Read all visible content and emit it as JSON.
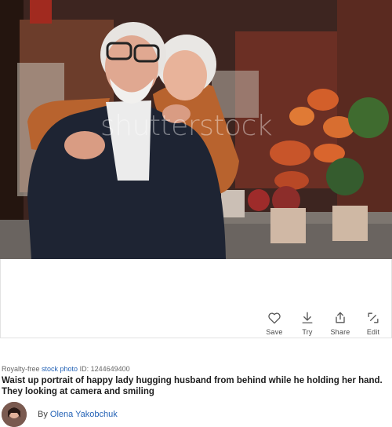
{
  "image": {
    "watermark_text": "shutterstock",
    "colors": {
      "background": "#4a2d25",
      "jacket": "#1e2433",
      "sweater": "#ececec",
      "woman_jacket": "#b8632e",
      "hair": "#e6e6e6",
      "pumpkin": "#d35f2a"
    }
  },
  "actions": [
    {
      "label": "Save",
      "icon": "heart-icon"
    },
    {
      "label": "Try",
      "icon": "download-icon"
    },
    {
      "label": "Share",
      "icon": "share-icon"
    },
    {
      "label": "Edit",
      "icon": "edit-icon"
    }
  ],
  "meta": {
    "prefix": "Royalty-free ",
    "type_link": "stock photo",
    "id_text": " ID: 1244649400"
  },
  "title": "Waist up portrait of happy lady hugging husband from behind while he holding her hand. They looking at camera and smiling",
  "author": {
    "by_label": "By ",
    "name": "Olena Yakobchuk"
  }
}
